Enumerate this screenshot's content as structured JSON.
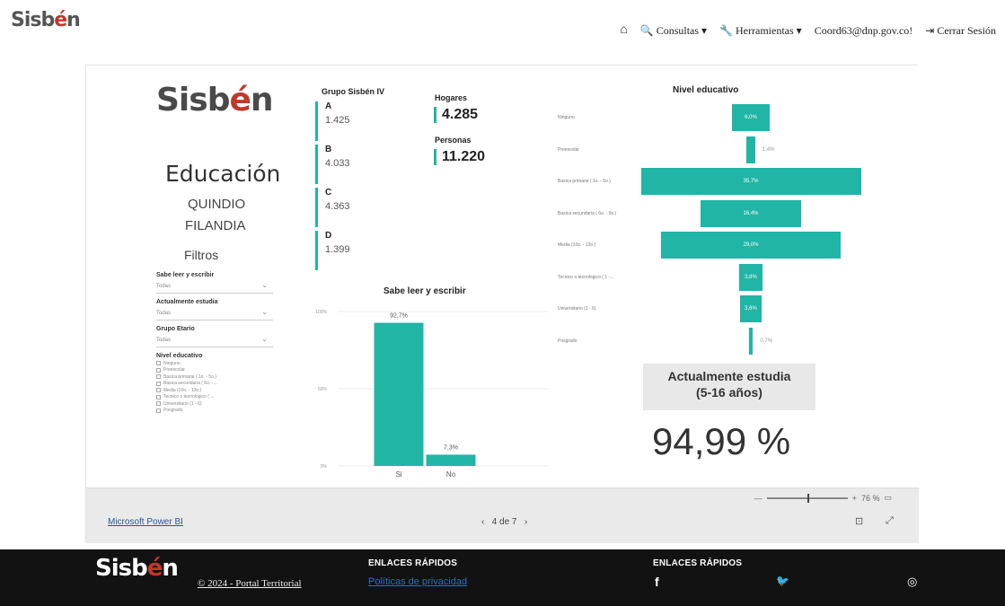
{
  "header": {
    "logo_main": "Sisb",
    "logo_e": "é",
    "logo_end": "n",
    "nav": {
      "consultas": "Consultas",
      "herramientas": "Herramientas",
      "email": "Coord63@dnp.gov.co!",
      "logout": "Cerrar Sesión"
    }
  },
  "report": {
    "logo_main": "Sisb",
    "logo_e": "é",
    "logo_end": "n",
    "title": "Educación",
    "department": "QUINDIO",
    "municipality": "FILANDIA",
    "filters_title": "Filtros",
    "filters": {
      "read_label": "Sabe leer y escribir",
      "read_value": "Todas",
      "study_label": "Actualmente estudia",
      "study_value": "Todas",
      "age_label": "Grupo Etario",
      "age_value": "Todas",
      "edu_label": "Nivel educativo",
      "edu_options": [
        "Ninguno",
        "Preescolar",
        "Basica primaria ( 1o. - 5o.)",
        "Basica secundaria ( 6o. - ...",
        "Media (10o. - 13o.)",
        "Tecnico o tecnologico ( ...",
        "Universitario (1 - 6)",
        "Posgrado"
      ]
    },
    "grupo_title": "Grupo Sisbén IV",
    "grupos": [
      {
        "label": "A",
        "value": "1.425"
      },
      {
        "label": "B",
        "value": "4.033"
      },
      {
        "label": "C",
        "value": "4.363"
      },
      {
        "label": "D",
        "value": "1.399"
      }
    ],
    "hogares_label": "Hogares",
    "hogares_value": "4.285",
    "personas_label": "Personas",
    "personas_value": "11.220",
    "study_card_title_1": "Actualmente estudia",
    "study_card_title_2": "(5-16 años)",
    "study_card_value": "94,99 %"
  },
  "chart_data": [
    {
      "type": "bar",
      "title": "Sabe leer y escribir",
      "categories": [
        "Si",
        "No"
      ],
      "values": [
        92.7,
        7.3
      ],
      "value_labels": [
        "92,7%",
        "7,3%"
      ],
      "ytick_labels": [
        "100%",
        "50%",
        "0%"
      ],
      "ylim": [
        0,
        100
      ]
    },
    {
      "type": "bar",
      "title": "Nivel educativo",
      "orientation": "horizontal-funnel",
      "categories": [
        "Ninguno",
        "Preescolar",
        "Basica primaria ( 1o. - 5o.)",
        "Basica secundaria ( 6o. - 9o.)",
        "Media (10o. - 13o.)",
        "Tecnico o tecnologico ( 1 -...",
        "Universitario (1 - 6)",
        "Posgrado"
      ],
      "values": [
        6.0,
        1.4,
        35.7,
        16.4,
        29.0,
        3.8,
        3.6,
        0.7
      ],
      "value_labels": [
        "6,0%",
        "1,4%",
        "35,7%",
        "16,4%",
        "29,0%",
        "3,8%",
        "3,6%",
        "0,7%"
      ]
    }
  ],
  "powerbi": {
    "link": "Microsoft Power BI",
    "pager": "4 de 7",
    "zoom": "76 %"
  },
  "footer": {
    "copyright": "© 2024 - Portal Territorial",
    "links_title_1": "ENLACES RÁPIDOS",
    "privacy": "Políticas de privacidad",
    "links_title_2": "ENLACES RÁPIDOS",
    "facebook": "f",
    "twitter": "🐦",
    "instagram": "◎"
  }
}
